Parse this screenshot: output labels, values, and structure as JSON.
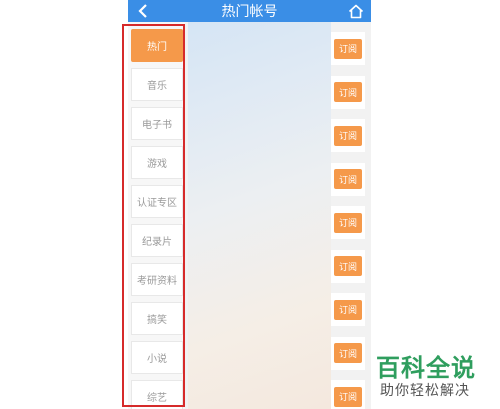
{
  "header": {
    "title": "热门帐号",
    "back_icon": "chevron-left-icon",
    "home_icon": "home-icon",
    "bar_color": "#3a8ee6"
  },
  "sidebar": {
    "items": [
      {
        "label": "热门",
        "active": true
      },
      {
        "label": "音乐",
        "active": false
      },
      {
        "label": "电子书",
        "active": false
      },
      {
        "label": "游戏",
        "active": false
      },
      {
        "label": "认证专区",
        "active": false
      },
      {
        "label": "纪录片",
        "active": false
      },
      {
        "label": "考研资料",
        "active": false
      },
      {
        "label": "搞笑",
        "active": false
      },
      {
        "label": "小说",
        "active": false
      },
      {
        "label": "综艺",
        "active": false
      }
    ],
    "active_color": "#f5994a"
  },
  "subscribe": {
    "label": "订阅",
    "count": 9,
    "color": "#f5994a"
  },
  "watermark": {
    "title": "百科全说",
    "subtitle": "助你轻松解决"
  },
  "highlight_color": "#d62a2a"
}
